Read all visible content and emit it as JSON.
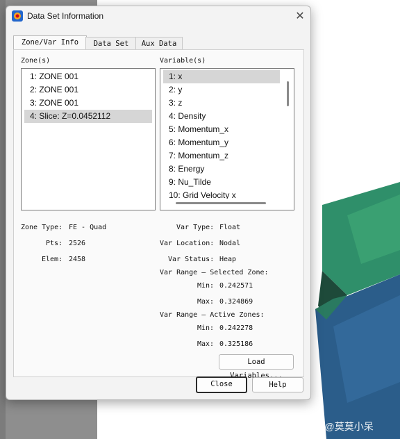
{
  "window": {
    "title": "Data Set Information"
  },
  "tabs": [
    {
      "label": "Zone/Var Info"
    },
    {
      "label": "Data Set"
    },
    {
      "label": "Aux Data"
    }
  ],
  "zones": {
    "label": "Zone(s)",
    "items": [
      "1: ZONE 001",
      "2: ZONE 001",
      "3: ZONE 001",
      "4: Slice: Z=0.0452112"
    ],
    "selected_index": 3
  },
  "variables": {
    "label": "Variable(s)",
    "items": [
      "1: x",
      "2: y",
      "3: z",
      "4: Density",
      "5: Momentum_x",
      "6: Momentum_y",
      "7: Momentum_z",
      "8: Energy",
      "9: Nu_Tilde",
      "10: Grid Velocity x"
    ],
    "selected_index": 0
  },
  "zone_info": {
    "zone_type_label": "Zone Type:",
    "zone_type_value": "FE - Quad",
    "pts_label": "Pts:",
    "pts_value": "2526",
    "elem_label": "Elem:",
    "elem_value": "2458"
  },
  "var_info": {
    "var_type_label": "Var Type:",
    "var_type_value": "Float",
    "var_location_label": "Var Location:",
    "var_location_value": "Nodal",
    "var_status_label": "Var Status:",
    "var_status_value": "Heap",
    "range_selected_label": "Var Range — Selected Zone:",
    "sel_min_label": "Min:",
    "sel_min_value": "0.242571",
    "sel_max_label": "Max:",
    "sel_max_value": "0.324869",
    "range_active_label": "Var Range — Active Zones:",
    "act_min_label": "Min:",
    "act_min_value": "0.242278",
    "act_max_label": "Max:",
    "act_max_value": "0.325186"
  },
  "buttons": {
    "load_variables": "Load Variables...",
    "close": "Close",
    "help": "Help"
  },
  "watermark": "CSDN @莫莫小呆",
  "colors": {
    "surface_green": "#2f8f6a",
    "surface_blue": "#2b5d8a",
    "surface_dark": "#1e4a3a"
  }
}
